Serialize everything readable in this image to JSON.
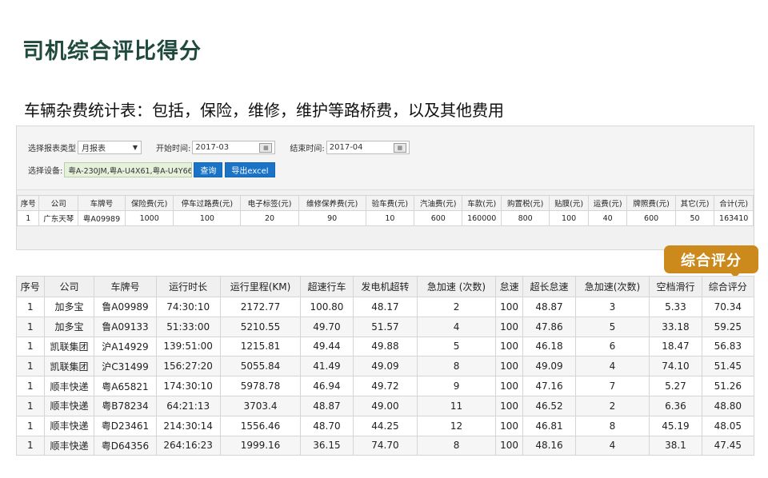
{
  "page": {
    "title": "司机综合评比得分",
    "subtitle": "车辆杂费统计表：包括，保险，维修，维护等路桥费，以及其他费用"
  },
  "form": {
    "report_type_label": "选择报表类型",
    "report_type_value": "月报表",
    "start_label": "开始时间:",
    "start_value": "2017-03",
    "end_label": "结束时间:",
    "end_value": "2017-04",
    "device_label": "选择设备:",
    "device_value": "粤A-230JM,粤A-U4X61,粤A-U4Y66",
    "query_label": "查询",
    "export_label": "导出excel"
  },
  "fees_table": {
    "headers": [
      "序号",
      "公司",
      "车牌号",
      "保险费(元)",
      "停车过路费(元)",
      "电子标签(元)",
      "维修保养费(元)",
      "验车费(元)",
      "汽油费(元)",
      "车款(元)",
      "购置税(元)",
      "贴膜(元)",
      "运费(元)",
      "牌照费(元)",
      "其它(元)",
      "合计(元)"
    ],
    "rows": [
      [
        "1",
        "广东天琴",
        "粤A09989",
        "1000",
        "100",
        "20",
        "90",
        "10",
        "600",
        "160000",
        "800",
        "100",
        "40",
        "600",
        "50",
        "163410"
      ]
    ]
  },
  "badge": {
    "label": "综合评分",
    "color": "#cc8a1d"
  },
  "score_table": {
    "headers": [
      "序号",
      "公司",
      "车牌号",
      "运行时长",
      "运行里程(KM)",
      "超速行车",
      "发电机超转",
      "急加速 (次数)",
      "怠速",
      "超长怠速",
      "急加速(次数)",
      "空档滑行",
      "综合评分"
    ],
    "rows": [
      [
        "1",
        "加多宝",
        "鲁A09989",
        "74:30:10",
        "2172.77",
        "100.80",
        "48.17",
        "2",
        "100",
        "48.87",
        "3",
        "5.33",
        "70.34"
      ],
      [
        "1",
        "加多宝",
        "鲁A09133",
        "51:33:00",
        "5210.55",
        "49.70",
        "51.57",
        "4",
        "100",
        "47.86",
        "5",
        "33.18",
        "59.25"
      ],
      [
        "1",
        "凯联集团",
        "沪A14929",
        "139:51:00",
        "1215.81",
        "49.44",
        "49.88",
        "5",
        "100",
        "46.18",
        "6",
        "18.47",
        "56.83"
      ],
      [
        "1",
        "凯联集团",
        "沪C31499",
        "156:27:20",
        "5055.84",
        "41.49",
        "49.09",
        "8",
        "100",
        "49.09",
        "4",
        "74.10",
        "51.45"
      ],
      [
        "1",
        "顺丰快递",
        "粤A65821",
        "174:30:10",
        "5978.78",
        "46.94",
        "49.72",
        "9",
        "100",
        "47.16",
        "7",
        "5.27",
        "51.26"
      ],
      [
        "1",
        "顺丰快递",
        "粤B78234",
        "64:21:13",
        "3703.4",
        "48.87",
        "49.00",
        "11",
        "100",
        "46.52",
        "2",
        "6.36",
        "48.80"
      ],
      [
        "1",
        "顺丰快递",
        "粤D23461",
        "214:30:14",
        "1556.46",
        "48.70",
        "44.25",
        "12",
        "100",
        "46.81",
        "8",
        "45.19",
        "48.05"
      ],
      [
        "1",
        "顺丰快递",
        "粤D64356",
        "264:16:23",
        "1999.16",
        "36.15",
        "74.70",
        "8",
        "100",
        "48.16",
        "4",
        "38.1",
        "47.45"
      ]
    ]
  }
}
